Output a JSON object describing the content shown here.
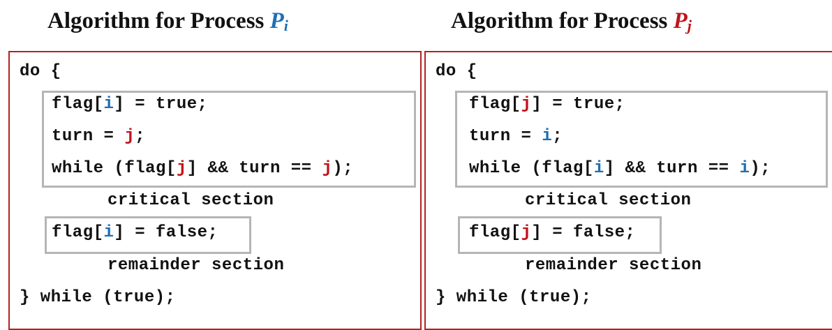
{
  "colors": {
    "index_i": "#1f6fb4",
    "index_j": "#c0141c",
    "panel_border": "#b22222",
    "box_border": "#b5b5b5"
  },
  "left": {
    "title_prefix": "Algorithm for Process ",
    "title_symbol": "P",
    "title_sub": "i",
    "do_line": "do {",
    "entry": {
      "line1": {
        "pre": "flag[",
        "idx": "i",
        "post": "] = true;"
      },
      "line2": {
        "pre": "turn = ",
        "idx": "j",
        "post": ";"
      },
      "line3": {
        "pre": "while (flag[",
        "idx1": "j",
        "mid": "] && turn == ",
        "idx2": "j",
        "post": ");"
      }
    },
    "critical": "critical section",
    "exit": {
      "pre": "flag[",
      "idx": "i",
      "post": "] = false;"
    },
    "remainder": "remainder section",
    "end_line": "} while (true);"
  },
  "right": {
    "title_prefix": "Algorithm for Process ",
    "title_symbol": "P",
    "title_sub": "j",
    "do_line": "do {",
    "entry": {
      "line1": {
        "pre": "flag[",
        "idx": "j",
        "post": "] = true;"
      },
      "line2": {
        "pre": "turn = ",
        "idx": "i",
        "post": ";"
      },
      "line3": {
        "pre": "while (flag[",
        "idx1": "i",
        "mid": "] && turn == ",
        "idx2": "i",
        "post": ");"
      }
    },
    "critical": "critical section",
    "exit": {
      "pre": "flag[",
      "idx": "j",
      "post": "] = false;"
    },
    "remainder": "remainder section",
    "end_line": "} while (true);"
  }
}
